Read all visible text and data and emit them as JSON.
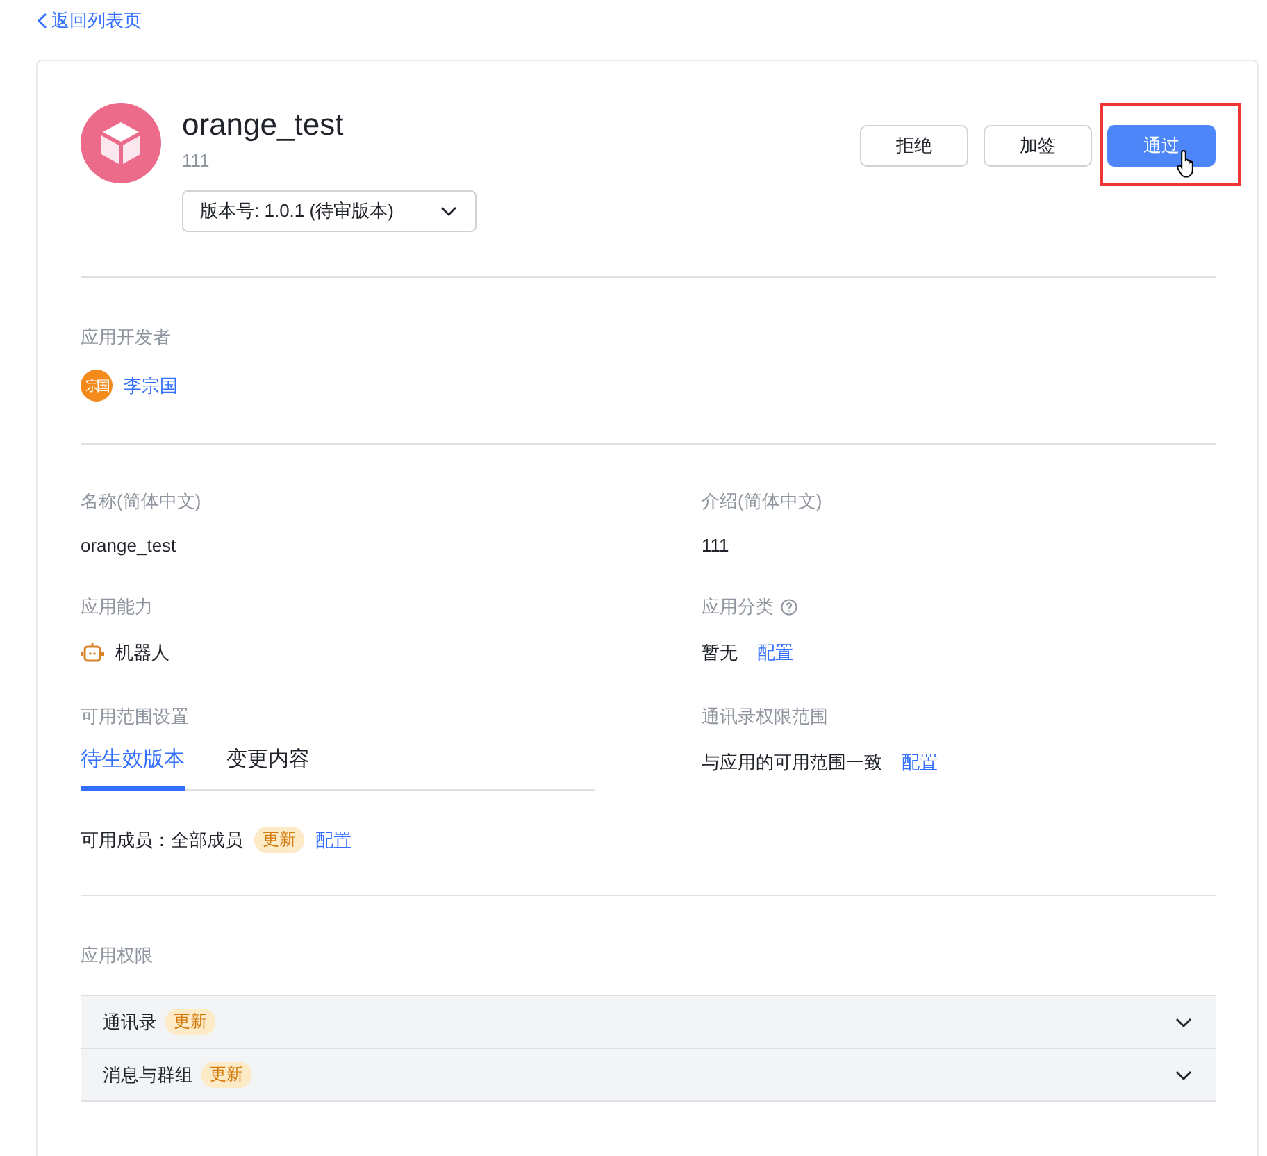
{
  "back_link": {
    "label": "返回列表页"
  },
  "app": {
    "name": "orange_test",
    "description": "111",
    "version_select": {
      "value": "版本号: 1.0.1 (待审版本)"
    }
  },
  "actions": [
    {
      "label": "拒绝",
      "kind": "default",
      "highlighted": false
    },
    {
      "label": "加签",
      "kind": "default",
      "highlighted": false
    },
    {
      "label": "通过",
      "kind": "primary",
      "highlighted": true
    }
  ],
  "developer": {
    "label": "应用开发者",
    "avatar_text": "宗国",
    "name": "李宗国"
  },
  "fields": [
    {
      "label": "名称(简体中文)",
      "value": "orange_test"
    },
    {
      "label": "介绍(简体中文)",
      "value": "111"
    },
    {
      "label": "应用能力",
      "value": "机器人",
      "kind": "capability"
    },
    {
      "label": "应用分类",
      "help": true,
      "value": "暂无",
      "link": "配置"
    },
    {
      "label": "可用范围设置",
      "tabs": [
        {
          "label": "待生效版本",
          "selected": true
        },
        {
          "label": "变更内容",
          "selected": false
        }
      ],
      "value": "可用成员：全部成员",
      "badge": "更新",
      "link": "配置"
    },
    {
      "label": "通讯录权限范围",
      "value": "与应用的可用范围一致",
      "link": "配置"
    }
  ],
  "permissions": {
    "label": "应用权限",
    "items": [
      {
        "name": "通讯录",
        "badge": "更新",
        "expanded": false
      },
      {
        "name": "消息与群组",
        "badge": "更新",
        "expanded": false
      }
    ]
  }
}
